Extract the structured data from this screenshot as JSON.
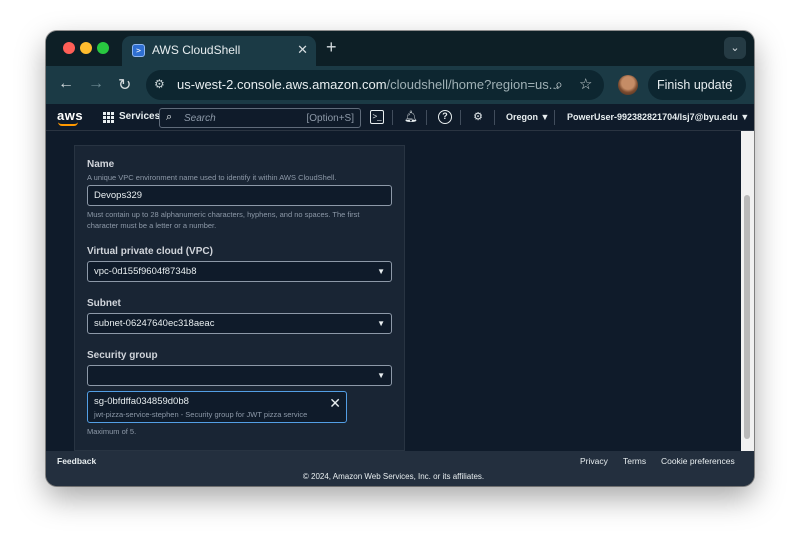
{
  "browser": {
    "tab_title": "AWS CloudShell",
    "tab_favicon": ">",
    "url_host": "us-west-2.console.aws.amazon.com",
    "url_path": "/cloudshell/home?region=us...",
    "finish_update_label": "Finish update"
  },
  "aws_nav": {
    "logo": "aws",
    "services_label": "Services",
    "search_placeholder": "Search",
    "search_shortcut": "[Option+S]",
    "region": "Oregon ▼",
    "user": "PowerUser-992382821704/lsj7@byu.edu ▼"
  },
  "form": {
    "name": {
      "label": "Name",
      "description": "A unique VPC environment name used to identify it within AWS CloudShell.",
      "value": "Devops329",
      "constraint_line1": "Must contain up to 28 alphanumeric characters, hyphens, and no spaces. The first",
      "constraint_line2": "character must be a letter or a number."
    },
    "vpc": {
      "label": "Virtual private cloud (VPC)",
      "value": "vpc-0d155f9604f8734b8"
    },
    "subnet": {
      "label": "Subnet",
      "value": "subnet-06247640ec318aeac"
    },
    "security_group": {
      "label": "Security group",
      "value": "",
      "selected": {
        "id": "sg-0bfdffa034859d0b8",
        "description": "jwt-pizza-service-stephen - Security group for JWT pizza service"
      },
      "max_note": "Maximum of 5."
    }
  },
  "footer": {
    "feedback": "Feedback",
    "privacy": "Privacy",
    "terms": "Terms",
    "cookie_preferences": "Cookie preferences",
    "copyright": "© 2024, Amazon Web Services, Inc. or its affiliates."
  }
}
